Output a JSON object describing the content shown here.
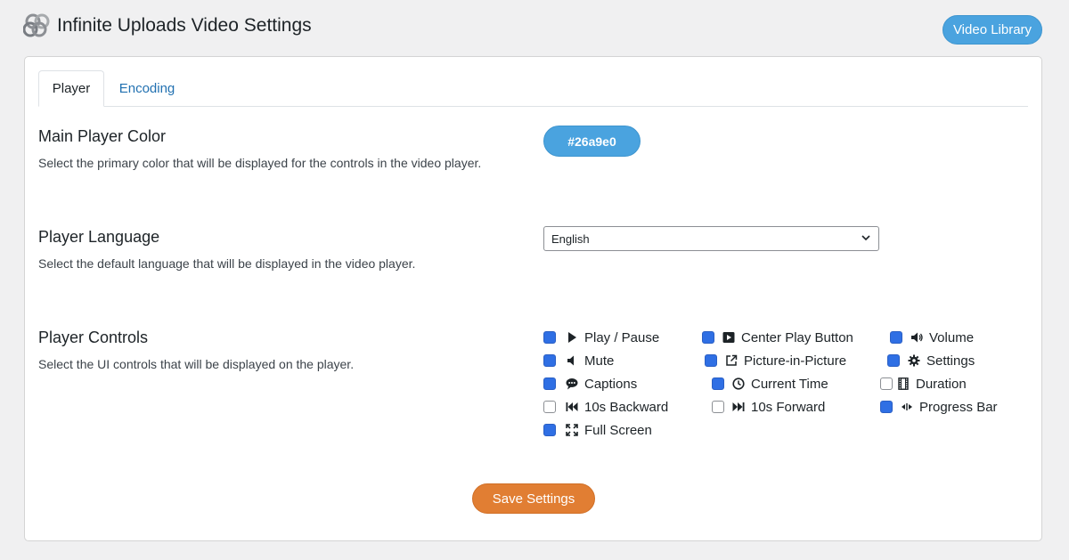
{
  "header": {
    "title": "Infinite Uploads Video Settings",
    "video_library_label": "Video Library"
  },
  "tabs": [
    {
      "label": "Player"
    },
    {
      "label": "Encoding"
    }
  ],
  "main_color": {
    "title": "Main Player Color",
    "description": "Select the primary color that will be displayed for the controls in the video player.",
    "value": "#26a9e0"
  },
  "language": {
    "title": "Player Language",
    "description": "Select the default language that will be displayed in the video player.",
    "selected": "English"
  },
  "controls": {
    "title": "Player Controls",
    "description": "Select the UI controls that will be displayed on the player.",
    "items": [
      {
        "label": "Play / Pause",
        "icon": "play-icon",
        "checked": true
      },
      {
        "label": "Center Play Button",
        "icon": "center-play-icon",
        "checked": true
      },
      {
        "label": "Volume",
        "icon": "volume-icon",
        "checked": true
      },
      {
        "label": "Mute",
        "icon": "mute-icon",
        "checked": true
      },
      {
        "label": "Picture-in-Picture",
        "icon": "pip-icon",
        "checked": true
      },
      {
        "label": "Settings",
        "icon": "gear-icon",
        "checked": true
      },
      {
        "label": "Captions",
        "icon": "captions-icon",
        "checked": true
      },
      {
        "label": "Current Time",
        "icon": "clock-icon",
        "checked": true
      },
      {
        "label": "Duration",
        "icon": "film-icon",
        "checked": false
      },
      {
        "label": "10s Backward",
        "icon": "backward-icon",
        "checked": false
      },
      {
        "label": "10s Forward",
        "icon": "forward-icon",
        "checked": false
      },
      {
        "label": "Progress Bar",
        "icon": "progress-icon",
        "checked": true
      },
      {
        "label": "Full Screen",
        "icon": "fullscreen-icon",
        "checked": true
      }
    ]
  },
  "save_label": "Save Settings",
  "colors": {
    "accent": "#4aa3df",
    "checkbox": "#2f6fe4",
    "save": "#e17e33",
    "link": "#2271b1"
  }
}
